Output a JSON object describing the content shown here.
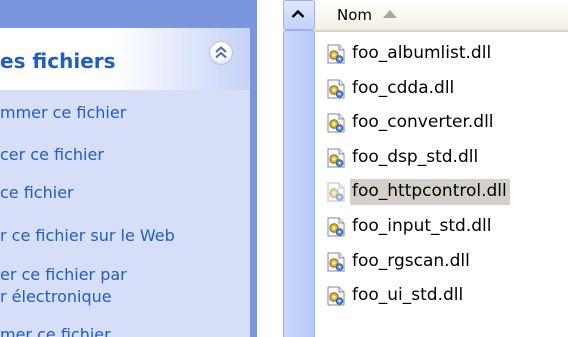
{
  "taskpane": {
    "title": "es fichiers",
    "links": [
      "mmer ce fichier",
      "cer ce fichier",
      "ce fichier",
      "r ce fichier sur le Web",
      "er ce fichier par",
      "r électronique",
      "mer ce fichier"
    ]
  },
  "filelist": {
    "column_header": "Nom",
    "sort_direction": "ascending",
    "selected_index": 4,
    "files": [
      {
        "name": "foo_albumlist.dll",
        "icon": "dll-file-icon"
      },
      {
        "name": "foo_cdda.dll",
        "icon": "dll-file-icon"
      },
      {
        "name": "foo_converter.dll",
        "icon": "dll-file-icon"
      },
      {
        "name": "foo_dsp_std.dll",
        "icon": "dll-file-icon"
      },
      {
        "name": "foo_httpcontrol.dll",
        "icon": "dll-file-icon"
      },
      {
        "name": "foo_input_std.dll",
        "icon": "dll-file-icon"
      },
      {
        "name": "foo_rgscan.dll",
        "icon": "dll-file-icon"
      },
      {
        "name": "foo_ui_std.dll",
        "icon": "dll-file-icon"
      }
    ]
  },
  "colors": {
    "link": "#215dc6",
    "selection": "#d4d0c8",
    "pane_body": "#d6dff7"
  }
}
